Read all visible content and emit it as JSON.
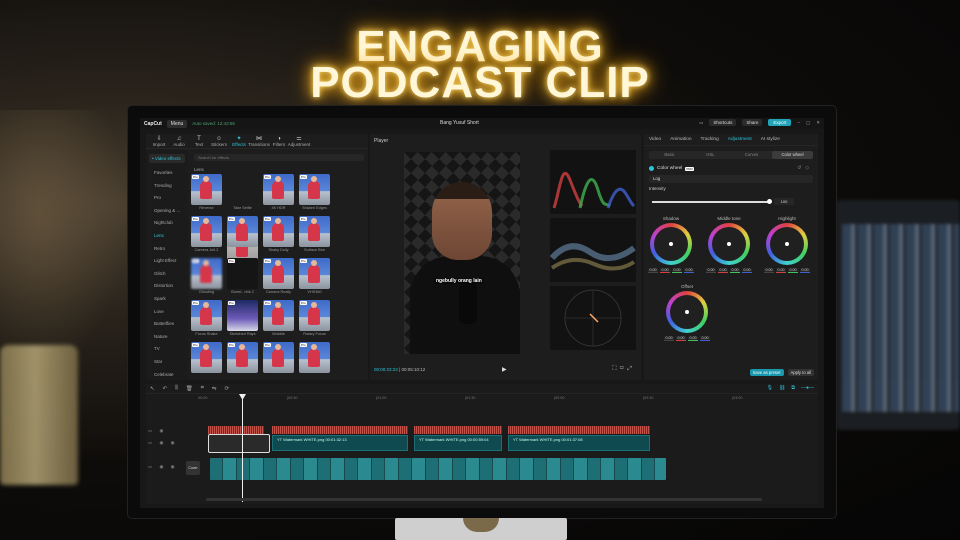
{
  "headline": {
    "line1": "ENGAGING",
    "line2": "PODCAST CLIP"
  },
  "colors": {
    "accent": "#2ec4d8",
    "export": "#21a3b8",
    "glow": "#ffbf2a"
  },
  "topbar": {
    "logo": "CapCut",
    "menu": "Menu",
    "autosave": "Auto saved: 12:43:56",
    "project": "Bang Yusuf Short",
    "shortcuts": "Shortcuts",
    "share": "Share",
    "export": "Export"
  },
  "toolbar": [
    {
      "label": "Import",
      "icon": "import-icon",
      "glyph": "⇩"
    },
    {
      "label": "Audio",
      "icon": "audio-icon",
      "glyph": "♫"
    },
    {
      "label": "Text",
      "icon": "text-icon",
      "glyph": "T"
    },
    {
      "label": "Stickers",
      "icon": "sticker-icon",
      "glyph": "☺"
    },
    {
      "label": "Effects",
      "icon": "effects-icon",
      "glyph": "✦"
    },
    {
      "label": "Transitions",
      "icon": "transitions-icon",
      "glyph": "⋈"
    },
    {
      "label": "Filters",
      "icon": "filters-icon",
      "glyph": "◑"
    },
    {
      "label": "Adjustment",
      "icon": "adjustment-icon",
      "glyph": "⚌"
    }
  ],
  "effects": {
    "main_category": "• Video effects",
    "categories": [
      "Favorites",
      "Trending",
      "Pro",
      "Opening & ...",
      "Nightclub",
      "Lens",
      "Retro",
      "Light Effect",
      "Glitch",
      "Distortion",
      "Spark",
      "Love",
      "Butterflies",
      "Nature",
      "TV",
      "Star",
      "Celebrate"
    ],
    "selected_category": "Lens",
    "search_placeholder": "Search for effects",
    "section": "Lens",
    "thumbs": [
      "Reverse",
      "Take Selfie",
      "4K HDR",
      "Shaken Edges",
      "Camera Jolt 2",
      "Tracki...Shot 2",
      "Shaky Dolly",
      "Surface Blur",
      "Ghosting",
      "Borrel...rink 2",
      "Camera Really",
      "VHS360",
      "Focus Shake",
      "Stretched Rays",
      "Wobble",
      "Rotary Focus",
      "",
      "",
      "",
      ""
    ],
    "thumb_badges": [
      "Pro",
      "Pro",
      "Pro",
      "Pro",
      "Pro",
      "Pro",
      "Pro",
      "Pro",
      "Pro",
      "Pro",
      "Pro",
      "Pro",
      "Pro",
      "Pro",
      "Pro",
      "Pro",
      "Pro",
      "Pro",
      "Pro",
      "Pro"
    ]
  },
  "player": {
    "title": "Player",
    "caption": "ngebully orang lain",
    "current_time": "00:00:23:23",
    "total_time": "00:05:10:12"
  },
  "inspector": {
    "tabs": [
      "Video",
      "Animation",
      "Tracking",
      "Adjustment",
      "AI stylize"
    ],
    "active_tab": "Adjustment",
    "subtabs": [
      "Basic",
      "HSL",
      "Curves",
      "Color wheel"
    ],
    "active_subtab": "Color wheel",
    "color_wheel_label": "Color wheel",
    "pro_badge": "PRO",
    "mode": "Log",
    "intensity_label": "Intensity",
    "intensity_value": "100",
    "wheels": [
      {
        "label": "Shadow",
        "values": [
          "0.00",
          "0.00",
          "0.00",
          "0.00"
        ]
      },
      {
        "label": "Middle tone",
        "values": [
          "0.00",
          "0.00",
          "0.00",
          "0.00"
        ]
      },
      {
        "label": "Highlight",
        "values": [
          "0.00",
          "0.00",
          "0.00",
          "0.00"
        ]
      },
      {
        "label": "Offset",
        "values": [
          "0.00",
          "0.00",
          "0.00",
          "0.00"
        ]
      }
    ],
    "save_preset": "Save as preset",
    "apply_all": "Apply to all"
  },
  "timeline": {
    "ruler": [
      "00:00",
      "|00:30",
      "|01:00",
      "|01:30",
      "|02:00",
      "|02:30",
      "|03:00"
    ],
    "overlays": [
      {
        "label": "YT Watermark WHITE.png  00:01:32:13"
      },
      {
        "label": "YT Watermark WHITE.png  00:00:59:04"
      },
      {
        "label": "YT Watermark WHITE.png  00:01:37:08"
      }
    ],
    "cover": "Cover"
  }
}
